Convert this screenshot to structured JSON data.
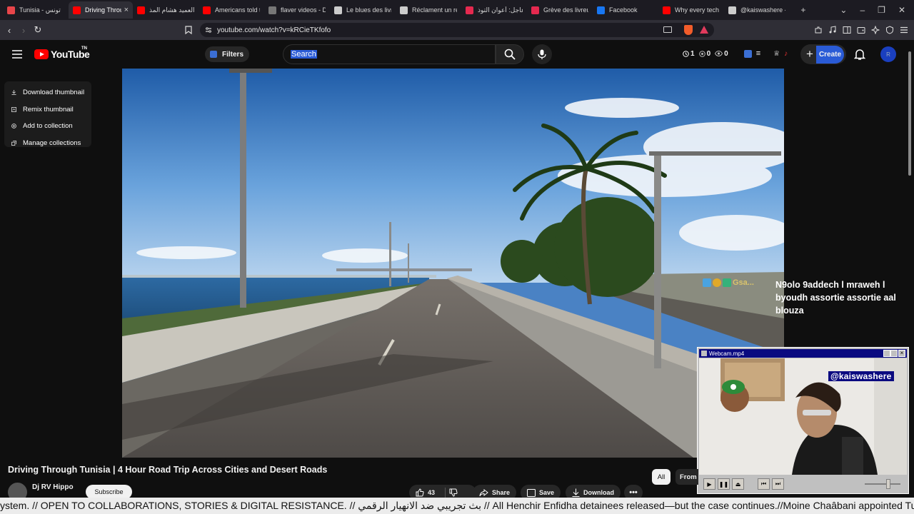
{
  "browser": {
    "tabs": [
      {
        "title": "Tunisia - تونس",
        "color": "#e8454a",
        "active": false
      },
      {
        "title": "Driving Throu",
        "color": "#ff0000",
        "active": true
      },
      {
        "title": "العميد هشام المذ",
        "color": "#ff0000",
        "active": false
      },
      {
        "title": "Americans told t",
        "color": "#ff0000",
        "active": false
      },
      {
        "title": "flaver videos - D",
        "color": "#777777",
        "active": false
      },
      {
        "title": "Le blues des livre",
        "color": "#cccccc",
        "active": false
      },
      {
        "title": "Réclament un re",
        "color": "#cccccc",
        "active": false
      },
      {
        "title": "عاجل: أعوان التوذ",
        "color": "#e5294f",
        "active": false
      },
      {
        "title": "Grève des livreur",
        "color": "#e5294f",
        "active": false
      },
      {
        "title": "Facebook",
        "color": "#1877f2",
        "active": false
      },
      {
        "title": "Why every tech c",
        "color": "#ff0000",
        "active": false
      },
      {
        "title": "@kaiswashere - ",
        "color": "#cccccc",
        "active": false
      }
    ],
    "url": "youtube.com/watch?v=kRCieTKfofo"
  },
  "youtube": {
    "logo_text": "YouTube",
    "logo_superscript": "TN",
    "filters_label": "Filters",
    "search_value": "Search",
    "counters": [
      "1",
      "0",
      "0"
    ],
    "create_label": "Create",
    "avatar_letter": "R"
  },
  "context_menu": {
    "items": [
      "Download thumbnail",
      "Remix thumbnail",
      "Add to collection",
      "Manage collections"
    ]
  },
  "video": {
    "title": "Driving Through Tunisia | 4 Hour Road Trip Across Cities and Desert Roads",
    "channel": "Dj RV Hippo",
    "subscribe_label": "Subscribe",
    "likes": "43",
    "share_label": "Share",
    "save_label": "Save",
    "download_label": "Download",
    "chip_all": "All",
    "chip_from": "From"
  },
  "overlay": {
    "chat_user": "Gsa...",
    "chat_message": "N9olo 9addech l mraweh l byoudh assortie assortie aal blouza",
    "webcam_title": "Webcam.mp4",
    "handle": "@kaiswashere",
    "ticker": "ystem. // OPEN TO COLLABORATIONS, STORIES & DIGITAL RESISTANCE. // بث تجريبي ضد الانهيار الرقمي // All Henchir Enfidha detainees released—but the case continues.//Moine Chaâbani appointed Tunisia"
  }
}
